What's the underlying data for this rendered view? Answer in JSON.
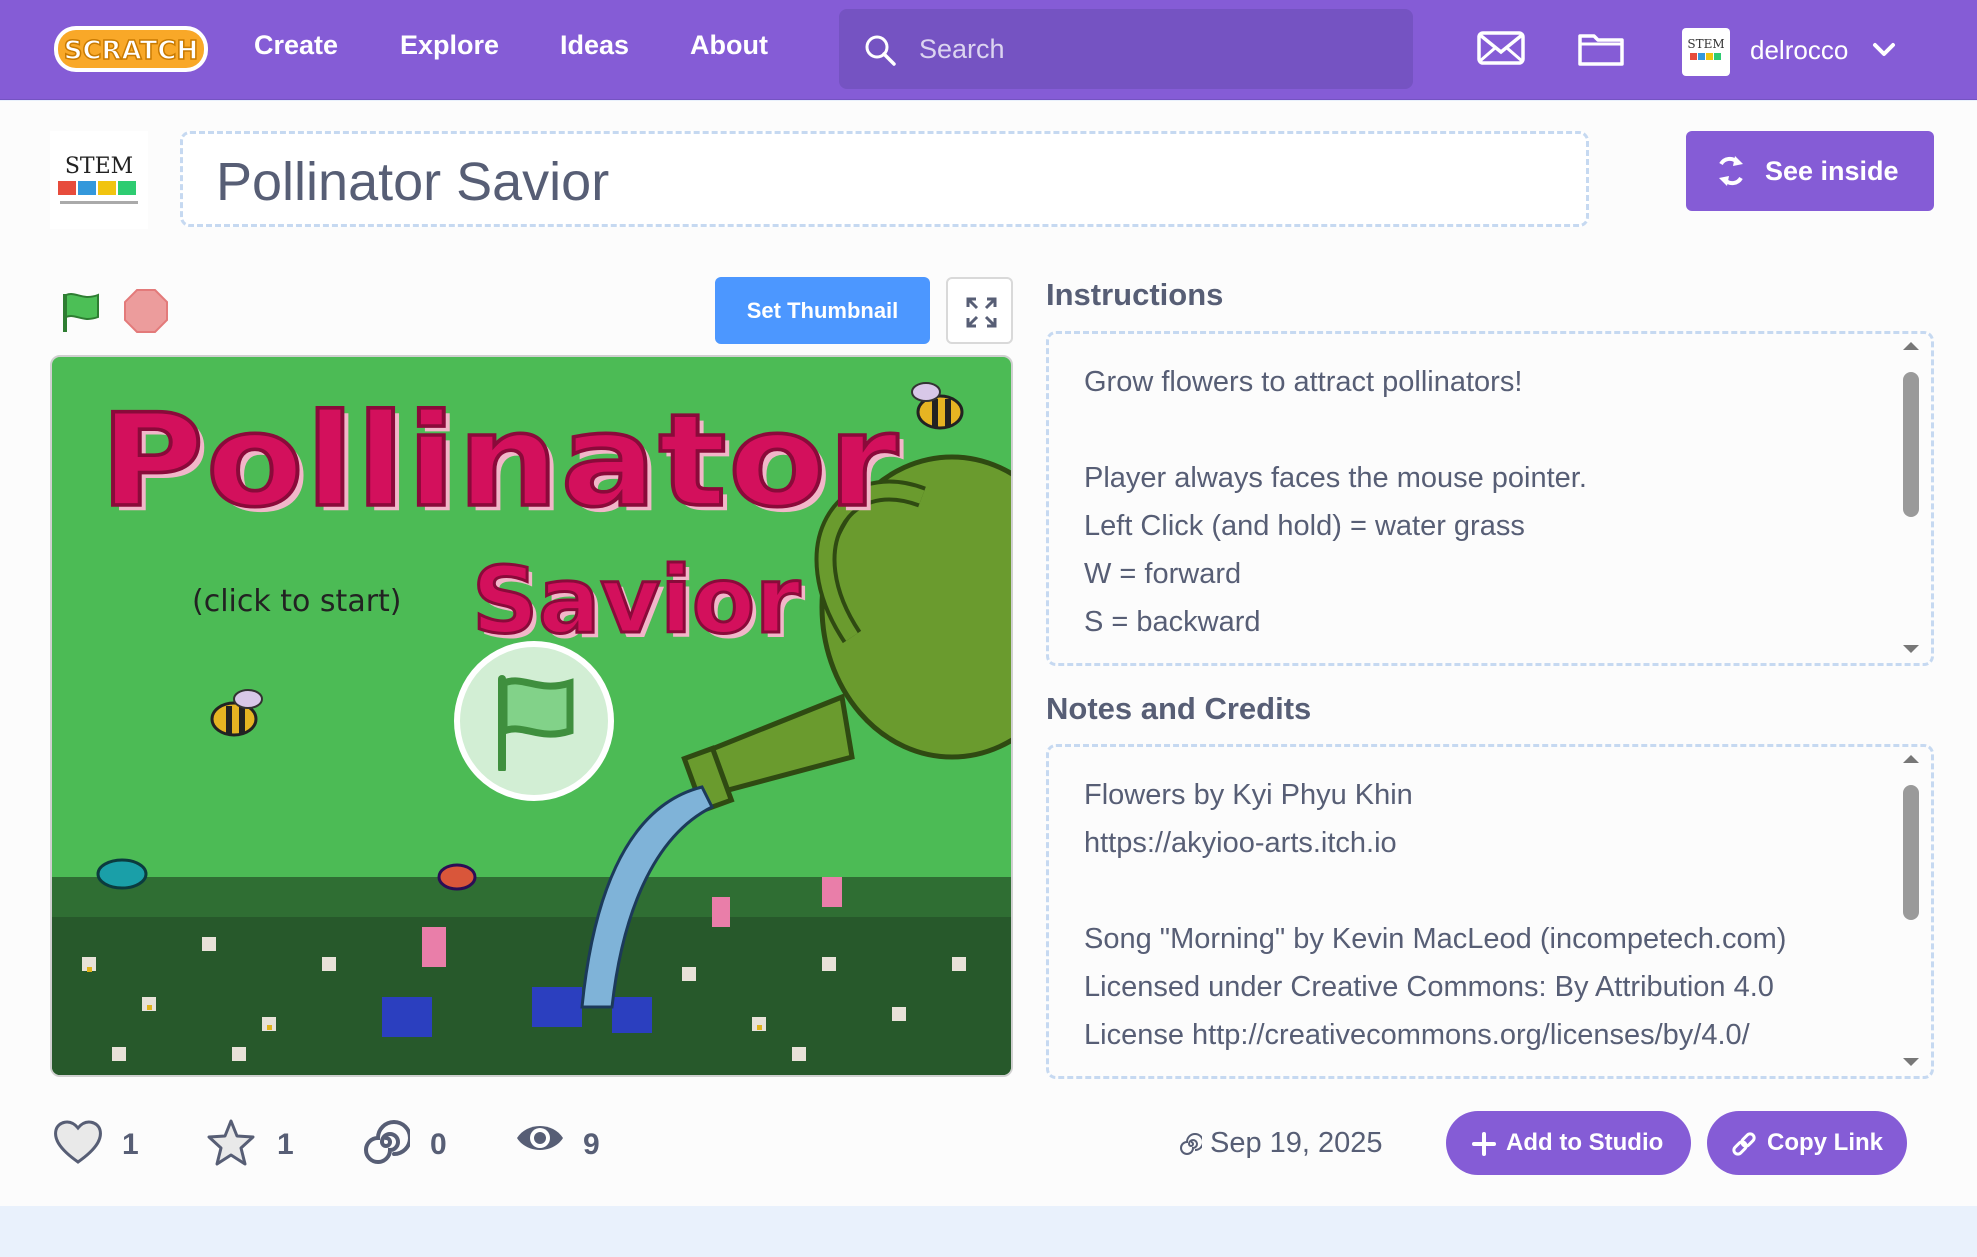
{
  "nav": {
    "logo_text": "SCRATCH",
    "links": [
      "Create",
      "Explore",
      "Ideas",
      "About"
    ],
    "search_placeholder": "Search",
    "username": "delrocco"
  },
  "project": {
    "avatar_text": "STEM",
    "title": "Pollinator Savior",
    "see_inside_label": "See inside"
  },
  "player": {
    "set_thumbnail_label": "Set Thumbnail",
    "stage_title_line1": "Pollinator",
    "stage_title_line2": "Savior",
    "click_to_start": "(click to start)"
  },
  "instructions": {
    "title": "Instructions",
    "lines": [
      "Grow flowers to attract pollinators!",
      "",
      "Player always faces the mouse pointer.",
      "Left Click (and hold) = water grass",
      "W = forward",
      "S = backward"
    ]
  },
  "notes": {
    "title": "Notes and Credits",
    "lines": [
      "Flowers by Kyi Phyu Khin",
      "https://akyioo-arts.itch.io",
      "",
      "Song \"Morning\" by Kevin MacLeod (incompetech.com)",
      "Licensed under Creative Commons: By Attribution 4.0",
      "License http://creativecommons.org/licenses/by/4.0/"
    ]
  },
  "stats": {
    "loves": "1",
    "favorites": "1",
    "remixes": "0",
    "views": "9"
  },
  "shared_date": "Sep 19, 2025",
  "actions": {
    "add_to_studio": "Add to Studio",
    "copy_link": "Copy Link"
  },
  "colors": {
    "brand": "#855cd6",
    "brand_dark": "#7553c2",
    "blue_button": "#4c97ff",
    "stage_green": "#4cbb55",
    "title_pink": "#d3105c"
  }
}
